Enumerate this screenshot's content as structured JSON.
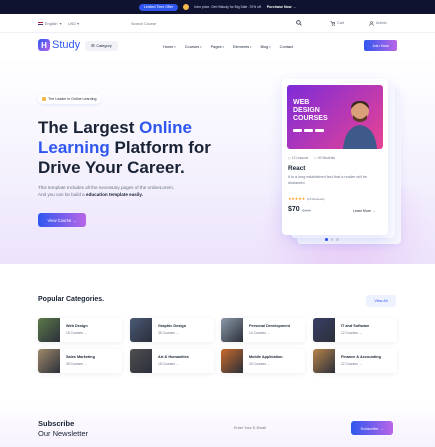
{
  "promo": {
    "badge": "Limited Time Offer",
    "text": "Intro price. Get Histudy for Big Sale -70% off.",
    "link": "Purchase Now →"
  },
  "utility": {
    "language": "English",
    "currency": "USD",
    "search_placeholder": "Search Course",
    "cart_label": "Cart",
    "admin_label": "Admin"
  },
  "nav": {
    "logo_text": "Study",
    "category_label": "Category",
    "menu": [
      "Home",
      "Courses",
      "Pages",
      "Elements",
      "Blog",
      "Contact"
    ],
    "join_label": "Join Now"
  },
  "hero": {
    "badge": "The Leader in Online Learning",
    "title_part1": "The Largest ",
    "title_highlight1": "Online",
    "title_highlight2": "Learning",
    "title_part2": " Platform for Drive Your Career.",
    "description_1": "This template Includes all the necessary pages of the onlineLorem.",
    "description_2": "And you can be build a ",
    "description_bold": "education template easily.",
    "button_label": "View Course →"
  },
  "course_card": {
    "thumb_title_1": "WEB",
    "thumb_title_2": "DESIGN",
    "thumb_title_3": "COURSES",
    "lessons": "12 Lessons",
    "students": "50 Students",
    "title": "React",
    "text": "It is a long established fact that a reader will be distracted.",
    "stars": "★★★★★",
    "reviews": "(15 Reviews)",
    "price": "$70",
    "old_price": "$120",
    "learn_more": "Learn More →"
  },
  "categories": {
    "title": "Popular Categories.",
    "view_all": "View All",
    "items": [
      {
        "name": "Web Design",
        "count": "15 Courses →",
        "color": "#5c7a4a"
      },
      {
        "name": "Graphic Design",
        "count": "35 Courses →",
        "color": "#4a5a78"
      },
      {
        "name": "Personal Development",
        "count": "14 Courses →",
        "color": "#8c9aa8"
      },
      {
        "name": "IT and Software",
        "count": "12 Courses →",
        "color": "#3a3f66"
      },
      {
        "name": "Sales Marketing",
        "count": "35 Courses →",
        "color": "#a08a6a"
      },
      {
        "name": "Art & Humanities",
        "count": "15 Courses →",
        "color": "#4f4f4f"
      },
      {
        "name": "Mobile Application",
        "count": "40 Courses →",
        "color": "#c86a2a"
      },
      {
        "name": "Finance & Accounting",
        "count": "22 Courses →",
        "color": "#b8844a"
      }
    ]
  },
  "newsletter": {
    "title": "Subscribe",
    "subtitle": "Our Newsletter",
    "placeholder": "Enter Your E-Email",
    "button_label": "Subscribe →"
  }
}
